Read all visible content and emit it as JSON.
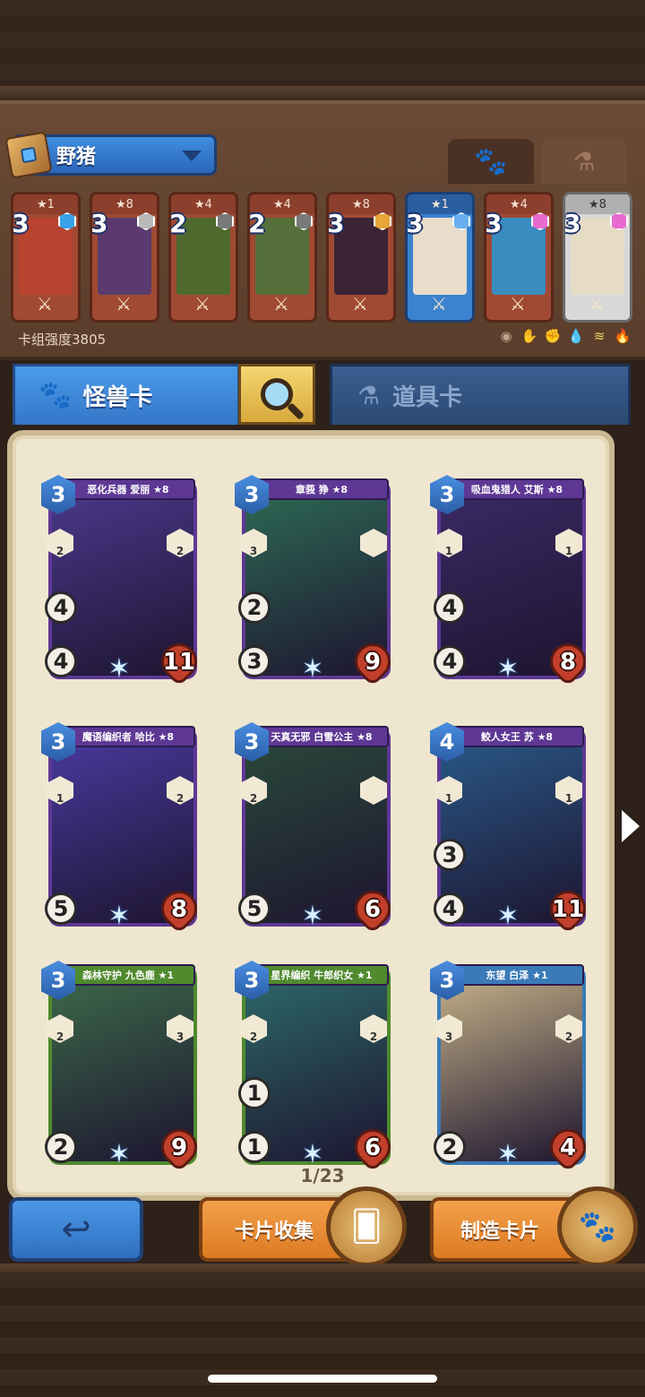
{
  "deck": {
    "name": "野猪",
    "strength": "卡组强度3805"
  },
  "deck_cards": [
    {
      "stars": "★1",
      "cost": "3",
      "gem_color": "#3aa0e8",
      "art": "#b8432f",
      "frame": "red"
    },
    {
      "stars": "★8",
      "cost": "3",
      "gem_color": "#b9b9b9",
      "art": "#5b3b6f",
      "frame": "red"
    },
    {
      "stars": "★4",
      "cost": "2",
      "gem_color": "#7a7a7a",
      "art": "#4e6a2f",
      "frame": "red"
    },
    {
      "stars": "★4",
      "cost": "2",
      "gem_color": "#7a7a7a",
      "art": "#55703a",
      "frame": "red"
    },
    {
      "stars": "★8",
      "cost": "3",
      "gem_color": "#e8a63a",
      "art": "#3b2433",
      "frame": "red"
    },
    {
      "stars": "★1",
      "cost": "3",
      "gem_color": "#6ab0f0",
      "art": "#e8dccb",
      "frame": "blue"
    },
    {
      "stars": "★4",
      "cost": "3",
      "gem_color": "#e86ad0",
      "art": "#3a8cc0",
      "frame": "red"
    },
    {
      "stars": "★8",
      "cost": "3",
      "gem_color": "#e86ad0",
      "art": "#e6dcc6",
      "frame": "gray"
    }
  ],
  "tabs": {
    "monster": "怪兽卡",
    "item": "道具卡"
  },
  "cards": [
    {
      "name": "恶化兵器 爱丽 ★8",
      "cost": "3",
      "atk": "4",
      "def": "4",
      "hp": "11",
      "hex_left": "2",
      "hex_right": "2",
      "art": "#4b3a8e",
      "frame_color": "#5e3894"
    },
    {
      "name": "章莪 狰 ★8",
      "cost": "3",
      "atk": "2",
      "def": "3",
      "hp": "9",
      "hex_left": "3",
      "hex_right": "",
      "art": "#2e6b55",
      "frame_color": "#5e3894"
    },
    {
      "name": "吸血鬼猎人 艾斯 ★8",
      "cost": "3",
      "atk": "4",
      "def": "4",
      "hp": "8",
      "hex_left": "1",
      "hex_right": "1",
      "art": "#3b2a66",
      "frame_color": "#5e3894"
    },
    {
      "name": "魔语编织者 哈比 ★8",
      "cost": "3",
      "atk": "",
      "def": "5",
      "hp": "8",
      "hex_left": "1",
      "hex_right": "2",
      "art": "#4a3aa0",
      "frame_color": "#5e3894"
    },
    {
      "name": "天真无邪 白雪公主 ★8",
      "cost": "3",
      "atk": "",
      "def": "5",
      "hp": "6",
      "hex_left": "2",
      "hex_right": "",
      "art": "#2a4a3a",
      "frame_color": "#5e3894"
    },
    {
      "name": "鲛人女王 苏 ★8",
      "cost": "4",
      "atk": "3",
      "def": "4",
      "hp": "11",
      "hex_left": "1",
      "hex_right": "1",
      "art": "#2a5a8a",
      "frame_color": "#5e3894"
    },
    {
      "name": "森林守护 九色鹿 ★1",
      "cost": "3",
      "atk": "",
      "def": "2",
      "hp": "9",
      "hex_left": "2",
      "hex_right": "3",
      "art": "#3d6b4a",
      "frame_color": "#4f8a2e"
    },
    {
      "name": "星界编织 牛郎织女 ★1",
      "cost": "3",
      "atk": "1",
      "def": "1",
      "hp": "6",
      "hex_left": "2",
      "hex_right": "2",
      "art": "#2d6a6a",
      "frame_color": "#4f8a2e"
    },
    {
      "name": "东望 白泽 ★1",
      "cost": "3",
      "atk": "",
      "def": "2",
      "hp": "4",
      "hex_left": "3",
      "hex_right": "2",
      "art": "#c9b58a",
      "frame_color": "#3a7ab8"
    }
  ],
  "pager": "1/23",
  "buttons": {
    "collect": "卡片收集",
    "craft": "制造卡片"
  },
  "icons": {
    "paw_tab": "paw-icon",
    "potion_tab": "potion-icon",
    "search": "magnifier-icon",
    "back": "back-arrow-icon"
  }
}
